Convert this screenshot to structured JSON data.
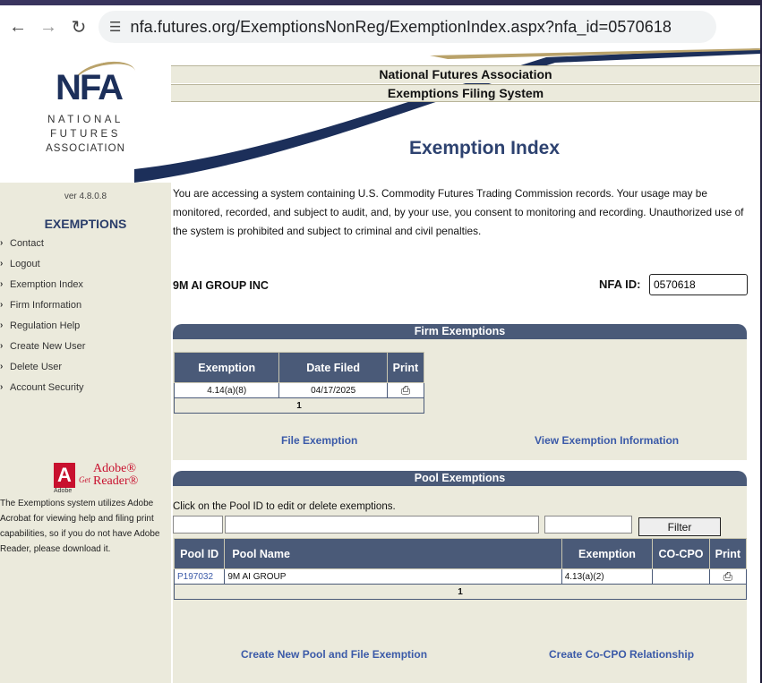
{
  "browser": {
    "url": "nfa.futures.org/ExemptionsNonReg/ExemptionIndex.aspx?nfa_id=0570618"
  },
  "sidebar": {
    "logo_text": "NFA",
    "org_lines": [
      "NATIONAL",
      "FUTURES",
      "ASSOCIATION"
    ],
    "version": "ver 4.8.0.8",
    "section_title": "EXEMPTIONS",
    "menu": [
      {
        "label": "Contact"
      },
      {
        "label": "Logout"
      },
      {
        "label": "Exemption Index"
      },
      {
        "label": "Firm Information"
      },
      {
        "label": "Regulation Help"
      },
      {
        "label": "Create New User"
      },
      {
        "label": "Delete User"
      },
      {
        "label": "Account Security"
      }
    ],
    "adobe": {
      "get": "Get",
      "brand": "Adobe®",
      "product": "Reader®",
      "small": "Adobe",
      "note": "The Exemptions system utilizes Adobe Acrobat for viewing help and filing print capabilities, so if you do not have Adobe Reader, please download it."
    }
  },
  "header": {
    "org": "National Futures Association",
    "system": "Exemptions Filing System",
    "page_title": "Exemption Index"
  },
  "notice": "You are accessing a system containing U.S. Commodity Futures Trading Commission records. Your usage may be monitored, recorded, and subject to audit, and, by your use, you consent to monitoring and recording. Unauthorized use of the system is prohibited and subject to criminal and civil penalties.",
  "firm": {
    "name": "9M AI GROUP INC",
    "nfa_id_label": "NFA ID:",
    "nfa_id_value": "0570618"
  },
  "firm_exemptions": {
    "title": "Firm Exemptions",
    "columns": [
      "Exemption",
      "Date Filed",
      "Print"
    ],
    "rows": [
      {
        "exemption": "4.14(a)(8)",
        "date_filed": "04/17/2025"
      }
    ],
    "page": "1",
    "links": {
      "file": "File Exemption",
      "view": "View Exemption Information"
    }
  },
  "pool_exemptions": {
    "title": "Pool Exemptions",
    "instruction": "Click on the Pool ID to edit or delete exemptions.",
    "filter_label": "Filter",
    "columns": [
      "Pool ID",
      "Pool Name",
      "Exemption",
      "CO-CPO",
      "Print"
    ],
    "rows": [
      {
        "pool_id": "P197032",
        "pool_name": "9M AI GROUP",
        "exemption": "4.13(a)(2)",
        "co_cpo": ""
      }
    ],
    "page": "1",
    "links": {
      "create": "Create New Pool and File Exemption",
      "cocpo": "Create Co-CPO Relationship"
    }
  },
  "colors": {
    "header_blue": "#4a5a78",
    "beige": "#ebeadc",
    "link_blue": "#3b5aa8",
    "title_blue": "#2d4270",
    "nfa_gold": "#b9a26a"
  }
}
